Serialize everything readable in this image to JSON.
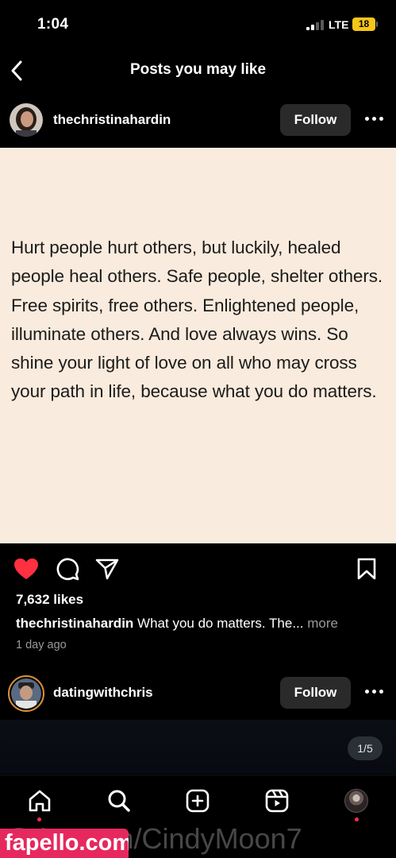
{
  "status_bar": {
    "time": "1:04",
    "network": "LTE",
    "battery": "18",
    "battery_color": "#f5c518"
  },
  "header": {
    "title": "Posts you may like",
    "back_icon": "chevron-left-icon"
  },
  "post": {
    "username": "thechristinahardin",
    "follow_label": "Follow",
    "image_background": "#f9ebdd",
    "quote_text": "Hurt people hurt others, but luckily, healed people heal others. Safe people, shelter others. Free spirits, free others. Enlightened people, illuminate others. And love always wins. So shine your light of love on all who may cross your path in life, because what you do matters.",
    "liked": true,
    "like_color": "#ff3040",
    "likes": "7,632 likes",
    "caption_user": "thechristinahardin",
    "caption_text": "What you do matters. The...",
    "more_label": "more",
    "time_ago": "1 day ago"
  },
  "next_post": {
    "username": "datingwithchris",
    "follow_label": "Follow",
    "carousel_counter": "1/5"
  },
  "tabbar": {
    "icons": [
      "home-icon",
      "search-icon",
      "create-icon",
      "reels-icon",
      "profile-avatar"
    ]
  },
  "watermark": {
    "logo_text": "fapello.com",
    "trail_text": "@ i  F    .c m/CindyMoon7"
  }
}
